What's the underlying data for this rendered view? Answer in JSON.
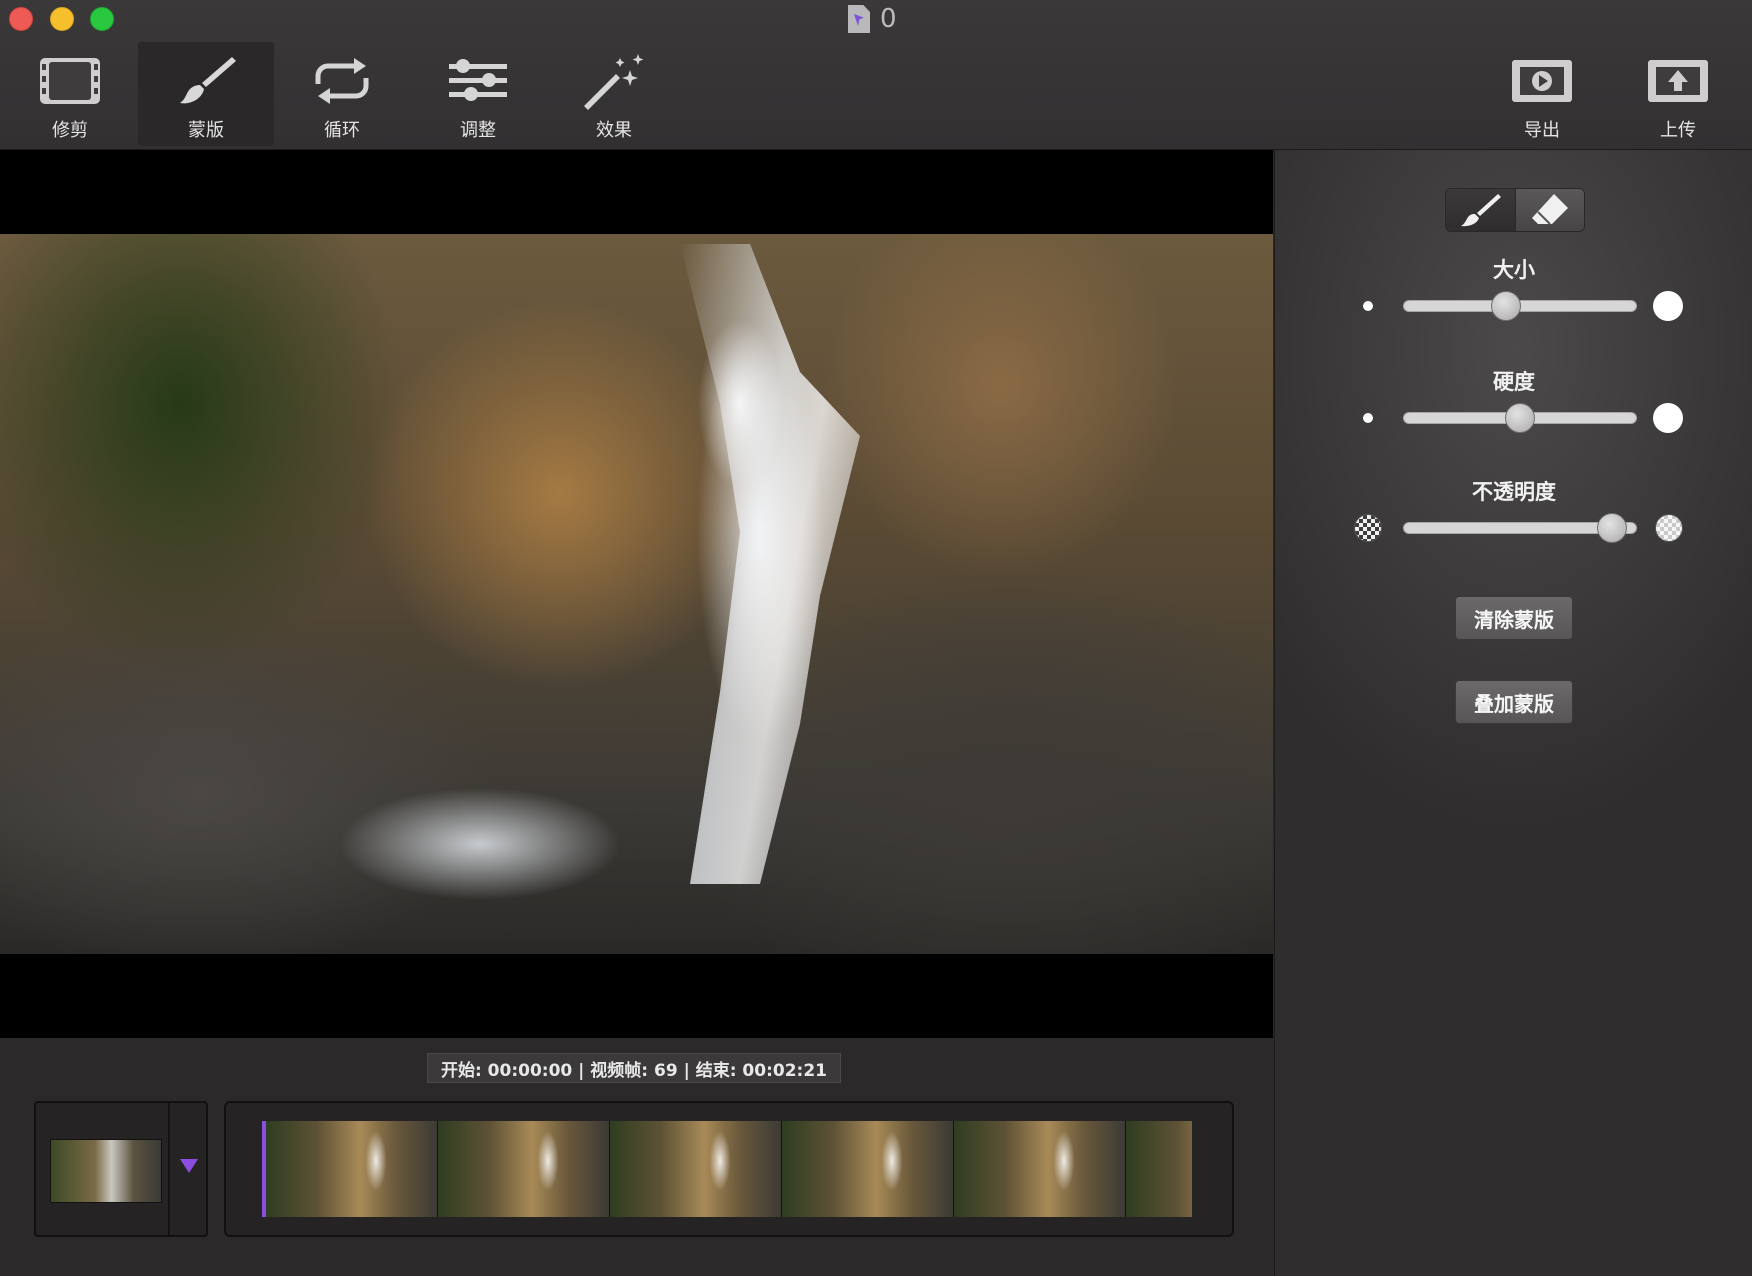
{
  "window": {
    "title": "0"
  },
  "toolbar": {
    "tools": [
      {
        "label": "修剪",
        "icon": "film-trim-icon"
      },
      {
        "label": "蒙版",
        "icon": "brush-icon",
        "active": true
      },
      {
        "label": "循环",
        "icon": "loop-icon"
      },
      {
        "label": "调整",
        "icon": "sliders-icon"
      },
      {
        "label": "效果",
        "icon": "magic-wand-icon"
      }
    ],
    "export_label": "导出",
    "upload_label": "上传"
  },
  "timeline": {
    "timecode": "开始: 00:00:00 | 视频帧: 69 | 结束: 00:02:21"
  },
  "panel": {
    "mode": "brush",
    "size": {
      "label": "大小",
      "value": 0.43
    },
    "hardness": {
      "label": "硬度",
      "value": 0.5
    },
    "opacity": {
      "label": "不透明度",
      "value": 0.95
    },
    "clear_mask_label": "清除蒙版",
    "add_mask_label": "叠加蒙版"
  },
  "colors": {
    "accent": "#8a4fe0",
    "panel_bg": "#3c3a3b"
  }
}
